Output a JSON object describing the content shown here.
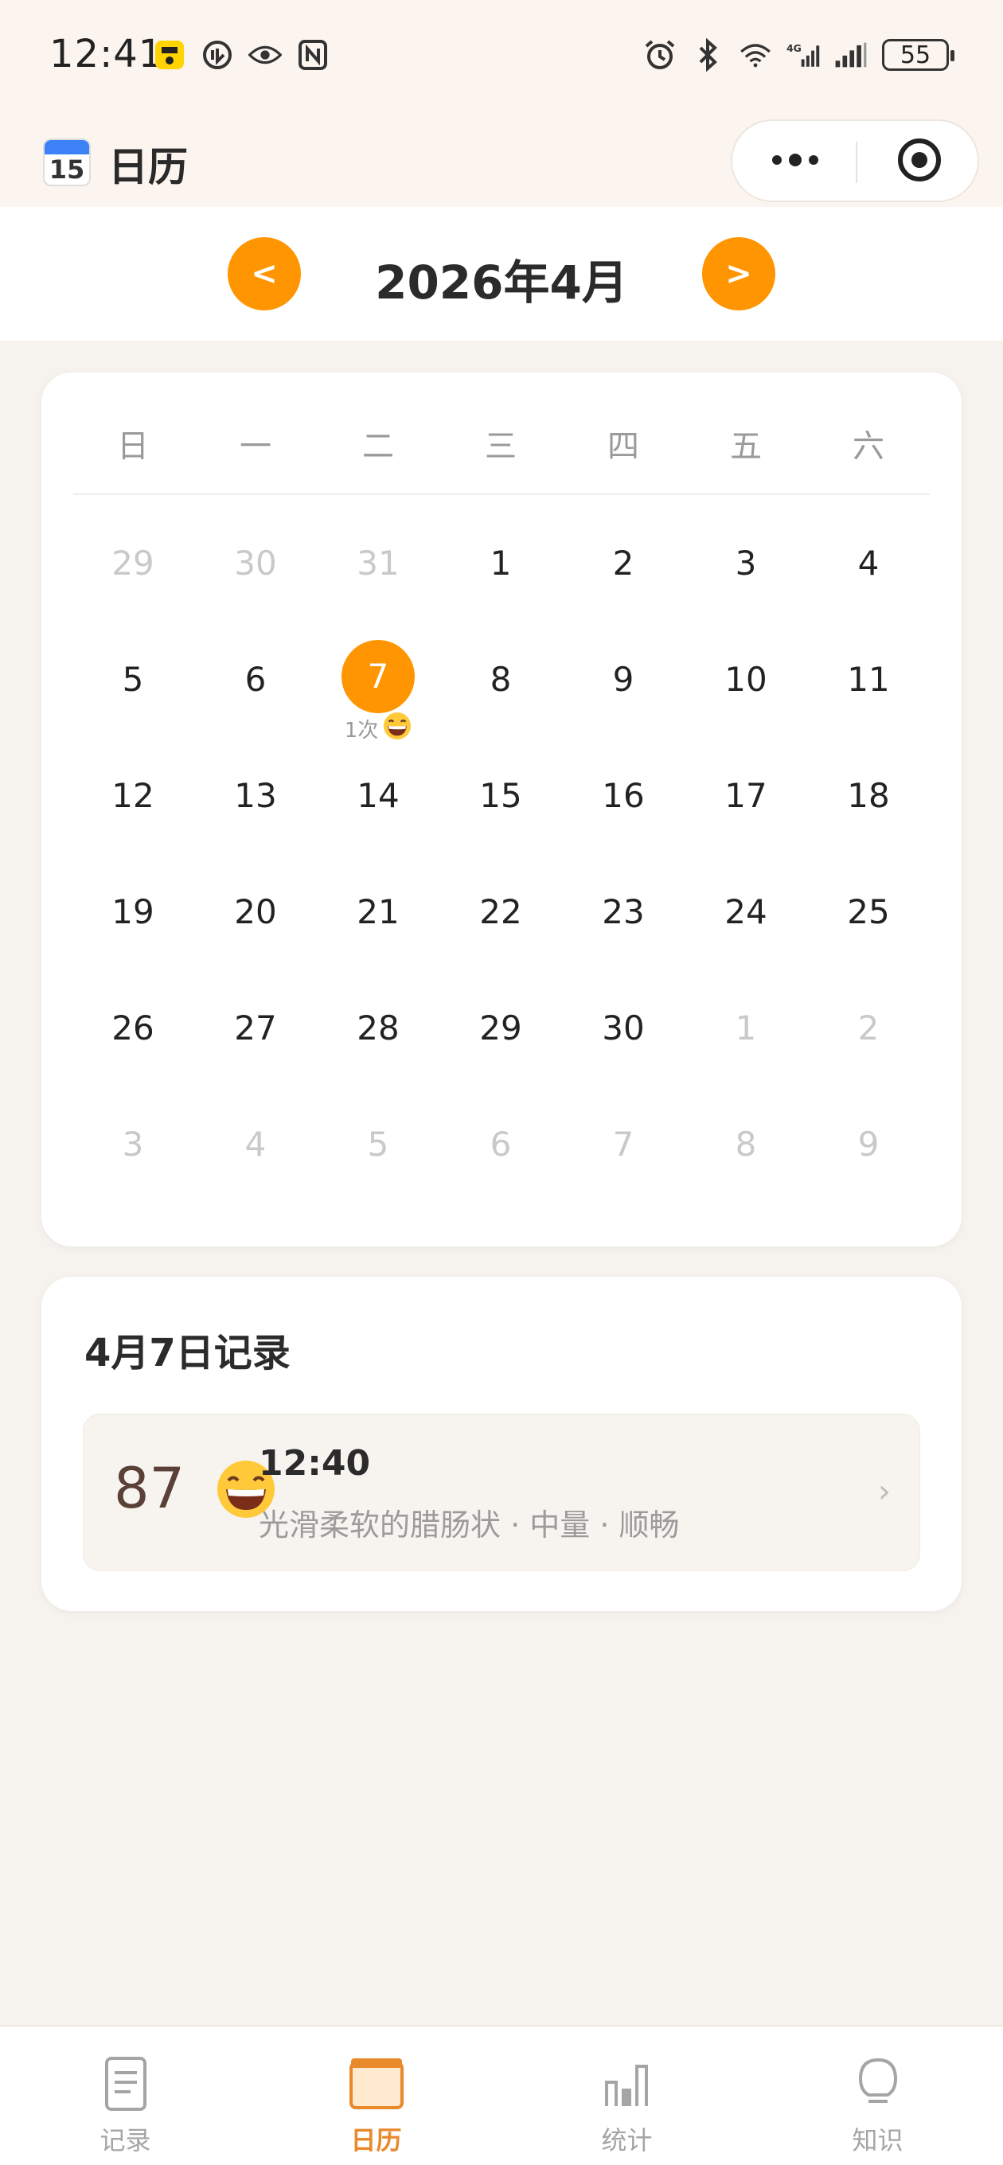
{
  "status_bar": {
    "time": "12:41",
    "battery": "55",
    "left_icons": [
      "app-badge-icon",
      "data-saver-icon",
      "eye-icon",
      "nfc-icon"
    ],
    "right_icons": [
      "alarm-icon",
      "bluetooth-icon",
      "wifi-icon",
      "signal-4g-icon",
      "signal-icon"
    ]
  },
  "title_bar": {
    "app_icon_text": "15",
    "title": "日历"
  },
  "month_nav": {
    "prev_label": "<",
    "next_label": ">",
    "title": "2026年4月"
  },
  "calendar": {
    "weekdays": [
      "日",
      "一",
      "二",
      "三",
      "四",
      "五",
      "六"
    ],
    "days": [
      {
        "n": "29",
        "other": true
      },
      {
        "n": "30",
        "other": true
      },
      {
        "n": "31",
        "other": true
      },
      {
        "n": "1"
      },
      {
        "n": "2"
      },
      {
        "n": "3"
      },
      {
        "n": "4"
      },
      {
        "n": "5"
      },
      {
        "n": "6"
      },
      {
        "n": "7",
        "selected": true,
        "note": "1次"
      },
      {
        "n": "8"
      },
      {
        "n": "9"
      },
      {
        "n": "10"
      },
      {
        "n": "11"
      },
      {
        "n": "12"
      },
      {
        "n": "13"
      },
      {
        "n": "14"
      },
      {
        "n": "15"
      },
      {
        "n": "16"
      },
      {
        "n": "17"
      },
      {
        "n": "18"
      },
      {
        "n": "19"
      },
      {
        "n": "20"
      },
      {
        "n": "21"
      },
      {
        "n": "22"
      },
      {
        "n": "23"
      },
      {
        "n": "24"
      },
      {
        "n": "25"
      },
      {
        "n": "26"
      },
      {
        "n": "27"
      },
      {
        "n": "28"
      },
      {
        "n": "29"
      },
      {
        "n": "30"
      },
      {
        "n": "1",
        "other": true
      },
      {
        "n": "2",
        "other": true
      },
      {
        "n": "3",
        "other": true
      },
      {
        "n": "4",
        "other": true
      },
      {
        "n": "5",
        "other": true
      },
      {
        "n": "6",
        "other": true
      },
      {
        "n": "7",
        "other": true
      },
      {
        "n": "8",
        "other": true
      },
      {
        "n": "9",
        "other": true
      }
    ]
  },
  "records": {
    "title": "4月7日记录",
    "item": {
      "score": "87",
      "time": "12:40",
      "description": "光滑柔软的腊肠状 · 中量 · 顺畅"
    }
  },
  "tabs": [
    {
      "label": "记录",
      "icon": "record-icon",
      "active": false
    },
    {
      "label": "日历",
      "icon": "calendar-icon",
      "active": true
    },
    {
      "label": "统计",
      "icon": "stats-icon",
      "active": false
    },
    {
      "label": "知识",
      "icon": "knowledge-icon",
      "active": false
    }
  ],
  "colors": {
    "accent": "#FF9500",
    "active_tab": "#E8892C",
    "background": "#F6F3EE"
  }
}
